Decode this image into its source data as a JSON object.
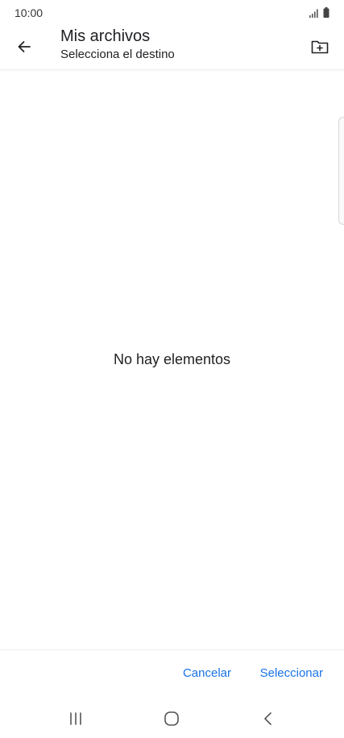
{
  "status_bar": {
    "time": "10:00",
    "icons": [
      "signal-icon",
      "battery-icon"
    ]
  },
  "app_bar": {
    "title": "Mis archivos",
    "subtitle": "Selecciona el destino",
    "back_icon": "arrow-left-icon",
    "new_folder_icon": "create-folder-icon"
  },
  "content": {
    "empty_message": "No hay elementos"
  },
  "actions": {
    "cancel_label": "Cancelar",
    "select_label": "Seleccionar",
    "accent_color": "#1a73e8"
  },
  "nav_bar": {
    "icons": [
      "recent-apps-icon",
      "home-icon",
      "back-icon"
    ]
  }
}
